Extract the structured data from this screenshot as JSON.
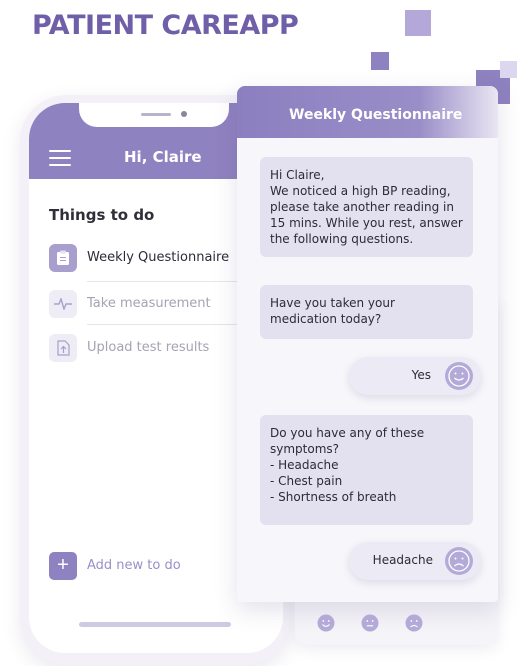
{
  "app": {
    "title": "PATIENT CAREAPP"
  },
  "phone": {
    "greeting": "Hi, Claire",
    "todo_heading": "Things to do",
    "todos": [
      {
        "label": "Weekly Questionnaire",
        "icon": "clipboard-icon",
        "active": true
      },
      {
        "label": "Take measurement",
        "icon": "heartbeat-icon",
        "active": false
      },
      {
        "label": "Upload test results",
        "icon": "document-upload-icon",
        "active": false
      }
    ],
    "add_label": "Add new to do"
  },
  "chat": {
    "title": "Weekly Questionnaire",
    "messages": [
      {
        "from": "bot",
        "lines": [
          "Hi Claire,",
          "We noticed a high BP reading,",
          "please take another reading in",
          "15 mins. While you rest, answer",
          "the following questions."
        ]
      },
      {
        "from": "bot",
        "lines": [
          "Have you taken your",
          "medication today?"
        ]
      },
      {
        "from": "user",
        "text": "Yes",
        "mood": "happy"
      },
      {
        "from": "bot",
        "lines": [
          "Do you have any of these",
          "symptoms?",
          "- Headache",
          "- Chest pain",
          "- Shortness of breath"
        ]
      },
      {
        "from": "user",
        "text": "Headache",
        "mood": "sad"
      }
    ],
    "mood_options": [
      "happy-face-icon",
      "neutral-face-icon",
      "sad-face-icon"
    ]
  },
  "colors": {
    "brand": "#6f5fa8",
    "header": "#8f82c0",
    "bubble": "#e3e0f0",
    "accent_light": "#b4aad8"
  }
}
